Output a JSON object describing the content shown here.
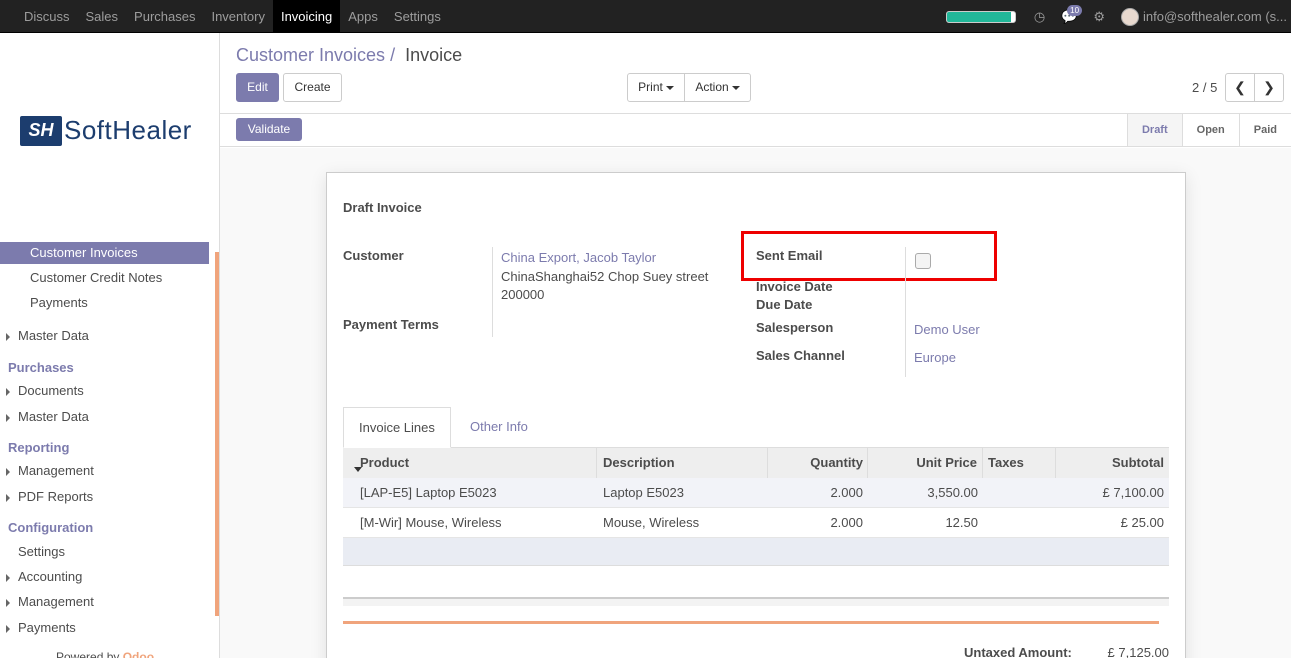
{
  "topnav": {
    "items": [
      "Discuss",
      "Sales",
      "Purchases",
      "Inventory",
      "Invoicing",
      "Apps",
      "Settings"
    ],
    "active": "Invoicing",
    "progress": 0.95,
    "chat_count": "10",
    "user": "info@softhealer.com (s..."
  },
  "sidebar": {
    "logo_mark": "SH",
    "logo_text": "SoftHealer",
    "items": [
      {
        "label": "Customer Invoices",
        "active": true
      },
      {
        "label": "Customer Credit Notes"
      },
      {
        "label": "Payments"
      },
      {
        "label": "Master Data"
      }
    ],
    "purchases": {
      "title": "Purchases",
      "items": [
        "Documents",
        "Master Data"
      ]
    },
    "reporting": {
      "title": "Reporting",
      "items": [
        "Management",
        "PDF Reports"
      ]
    },
    "configuration": {
      "title": "Configuration",
      "items": [
        "Settings",
        "Accounting",
        "Management",
        "Payments"
      ]
    },
    "powered_by": "Powered by",
    "powered_brand": "Odoo"
  },
  "breadcrumb": {
    "parent": "Customer Invoices",
    "separator": "/",
    "current": "Invoice"
  },
  "buttons": {
    "edit": "Edit",
    "create": "Create",
    "print": "Print",
    "action": "Action",
    "validate": "Validate"
  },
  "pager": {
    "value": "2 / 5"
  },
  "stages": [
    "Draft",
    "Open",
    "Paid"
  ],
  "current_stage": "Draft",
  "form": {
    "title": "Draft Invoice",
    "customer_label": "Customer",
    "customer_name": "China Export, Jacob Taylor",
    "customer_addr1": "ChinaShanghai52 Chop Suey street",
    "customer_addr2": "200000",
    "payment_terms_label": "Payment Terms",
    "sent_email_label": "Sent Email",
    "sent_email_checked": false,
    "invoice_date_label": "Invoice Date",
    "due_date_label": "Due Date",
    "salesperson_label": "Salesperson",
    "salesperson": "Demo User",
    "sales_channel_label": "Sales Channel",
    "sales_channel": "Europe"
  },
  "tabs": [
    "Invoice Lines",
    "Other Info"
  ],
  "table": {
    "headers": [
      "Product",
      "Description",
      "Quantity",
      "Unit Price",
      "Taxes",
      "Subtotal"
    ],
    "rows": [
      [
        "[LAP-E5] Laptop E5023",
        "Laptop E5023",
        "2.000",
        "3,550.00",
        "",
        "£ 7,100.00"
      ],
      [
        "[M-Wir] Mouse, Wireless",
        "Mouse, Wireless",
        "2.000",
        "12.50",
        "",
        "£ 25.00"
      ]
    ]
  },
  "totals": {
    "untaxed_label": "Untaxed Amount:",
    "untaxed_value": "£ 7,125.00"
  }
}
